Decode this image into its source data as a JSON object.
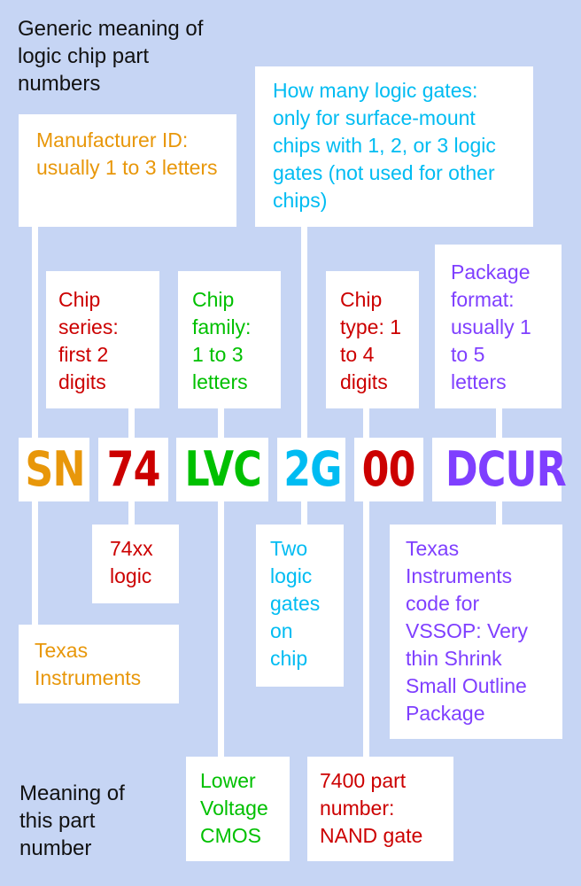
{
  "headings": {
    "generic": "Generic meaning of logic chip part numbers",
    "specific": "Meaning of this part number"
  },
  "colors": {
    "background": "#c6d5f4",
    "manufacturer": "#e8970a",
    "series": "#cc0000",
    "family": "#00c000",
    "gates": "#00bcf2",
    "type": "#cc0000",
    "package": "#7f3fff"
  },
  "part_number": {
    "segments": [
      {
        "id": "manufacturer",
        "text": "SN"
      },
      {
        "id": "series",
        "text": "74"
      },
      {
        "id": "family",
        "text": "LVC"
      },
      {
        "id": "gates",
        "text": "2G"
      },
      {
        "id": "type",
        "text": "00"
      },
      {
        "id": "package",
        "text": "DCUR"
      }
    ]
  },
  "generic": {
    "manufacturer": "Manufacturer ID: usually 1 to 3 letters",
    "gates": "How many logic gates: only for surface-mount chips with 1, 2, or 3 logic gates (not used for other chips)",
    "series": "Chip series: first 2 digits",
    "family": "Chip family: 1 to 3 letters",
    "type": "Chip type: 1 to 4 digits",
    "package": "Package format: usually 1 to 5 letters"
  },
  "specific": {
    "series": "74xx logic",
    "manufacturer": "Texas Instruments",
    "gates": "Two logic gates on chip",
    "package": "Texas Instruments code for VSSOP: Very thin Shrink Small Outline Package",
    "family": "Lower Voltage CMOS",
    "type": "7400 part number: NAND gate"
  }
}
